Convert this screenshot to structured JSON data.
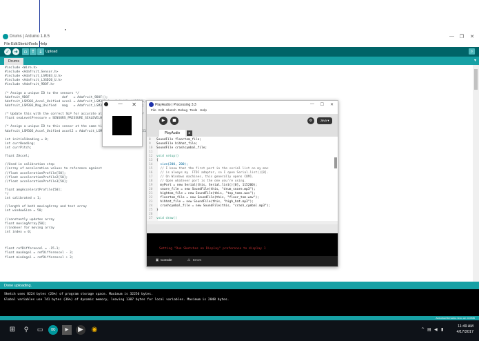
{
  "arduino": {
    "title": "Drums | Arduino 1.8.5",
    "menu": [
      "File",
      "Edit",
      "Sketch",
      "Tools",
      "Help"
    ],
    "toolbar": {
      "upload_label": "Upload"
    },
    "tab": "Drums",
    "code": [
      [
        "#include <Wire.h>",
        "tp"
      ],
      [
        "#include <Adafruit_Sensor.h>",
        "tp"
      ],
      [
        "#include <Adafruit_LSM303_U.h>",
        "tp"
      ],
      [
        "#include <Adafruit_L3GD20_U.h>",
        "tp"
      ],
      [
        "#include <Adafruit_9DOF.h>",
        "tp"
      ],
      [
        "",
        ""
      ],
      [
        "/* Assign a unique ID to the sensors */",
        "cm"
      ],
      [
        "Adafruit_9DOF                 dof   = Adafruit_9DOF();",
        ""
      ],
      [
        "Adafruit_LSM303_Accel_Unified accel = Adafruit_LSM303_Accel_Unified(30301);",
        ""
      ],
      [
        "Adafruit_LSM303_Mag_Unified   mag   = Adafruit_LSM303_Mag_Unified(30302);",
        ""
      ],
      [
        "",
        ""
      ],
      [
        "/* Update this with the correct SLP for accurate altitude measurements */",
        "cm"
      ],
      [
        "float seaLevelPressure = SENSORS_PRESSURE_SEALEVELHPA;",
        ""
      ],
      [
        "",
        ""
      ],
      [
        "/* Assign a unique ID to this sensor at the same time */",
        "cm"
      ],
      [
        "Adafruit_LSM303_Accel_Unified accel2 = Adafruit_LSM303_Accel_Unified(54321);",
        ""
      ],
      [
        "",
        ""
      ],
      [
        "int initialHeading = 0;",
        ""
      ],
      [
        "int currHeading;",
        ""
      ],
      [
        "int currPitch;",
        ""
      ],
      [
        "",
        ""
      ],
      [
        "float ZAccel;",
        ""
      ],
      [
        "",
        ""
      ],
      [
        "//Used in calibration step",
        "cm"
      ],
      [
        "//array of acceleration values to reference against",
        "cm"
      ],
      [
        "//float accelerationProfile[50];",
        "cm"
      ],
      [
        "//float accelerationProfile2[50];",
        "cm"
      ],
      [
        "//float accelerationProfile3[50];",
        "cm"
      ],
      [
        "",
        ""
      ],
      [
        "float amgAcceleratProfile[50];",
        ""
      ],
      [
        "*/",
        "cm"
      ],
      [
        "int calibrated = 1;",
        ""
      ],
      [
        "",
        ""
      ],
      [
        "//length of both movingArray and test array",
        "cm"
      ],
      [
        "int windowSize = 50;",
        ""
      ],
      [
        "",
        ""
      ],
      [
        "//constantly updates array",
        "cm"
      ],
      [
        "float movingArray[50];",
        ""
      ],
      [
        "//indexer for moving array",
        "cm"
      ],
      [
        "int index = 0;",
        ""
      ],
      [
        "",
        ""
      ],
      [
        "",
        ""
      ],
      [
        "",
        ""
      ],
      [
        "float refDifferencel = -15.1;",
        ""
      ],
      [
        "float maxAngel = refDifferencel - 3;",
        ""
      ],
      [
        "float minAngel = refDifferencel + 3;",
        ""
      ]
    ],
    "status": "Done uploading.",
    "console": [
      "Sketch uses 8224 bytes (26%) of program storage space. Maximum is 32256 bytes.",
      "Global variables use 741 bytes (36%) of dynamic memory, leaving 1307 bytes for local variables. Maximum is 2048 bytes."
    ],
    "board_info": "Arduino/Genuino Uno on COM6"
  },
  "pde": {
    "title": "PlayAudio | Processing 3.3",
    "menu": [
      "File",
      "Edit",
      "Sketch",
      "Debug",
      "Tools",
      "Help"
    ],
    "mode": "Java ▾",
    "tab": "PlayAudio",
    "lines": [
      [
        "SoundFile floortom_file;",
        ""
      ],
      [
        "SoundFile hihhat_file;",
        ""
      ],
      [
        "SoundFile crashcymbal_file;",
        ""
      ],
      [
        "",
        ""
      ],
      [
        "void setup()",
        "pk"
      ],
      [
        "{",
        ""
      ],
      [
        "  size(200, 200);",
        "pf"
      ],
      [
        "  // I know that the first port in the serial list on my mac",
        "pc"
      ],
      [
        "  // is always my  FTDI adaptor, so I open Serial.list()[0].",
        "pc"
      ],
      [
        "  // On Windows machines, this generally opens COM1.",
        "pc"
      ],
      [
        "  // Open whatever port is the one you're using.",
        "pc"
      ],
      [
        "  myPort = new Serial(this, Serial.list()[0], 115200);",
        ""
      ],
      [
        "  snare_file = new SoundFile(this, \"drum_snare.mp3\");",
        ""
      ],
      [
        "  hightom_file = new SoundFile(this, \"top_toms.wav\");",
        ""
      ],
      [
        "  floortom_file = new SoundFile(this, \"floor_tom.wav\");",
        ""
      ],
      [
        "  hihhat_file = new SoundFile(this, \"high_hat.mp3\");",
        ""
      ],
      [
        "  crashcymbal_file = new SoundFile(this, \"crash_cymbal.mp3\");",
        ""
      ],
      [
        "}",
        ""
      ],
      [
        "",
        ""
      ],
      [
        "void draw()",
        "pk"
      ]
    ],
    "line_start": 8,
    "console_msg": "Setting \"Run Sketches on Display\" preference to display 1",
    "footer": {
      "console": "Console",
      "errors": "Errors"
    }
  },
  "taskbar": {
    "time": "11:49 AM",
    "date": "4/17/2017"
  }
}
